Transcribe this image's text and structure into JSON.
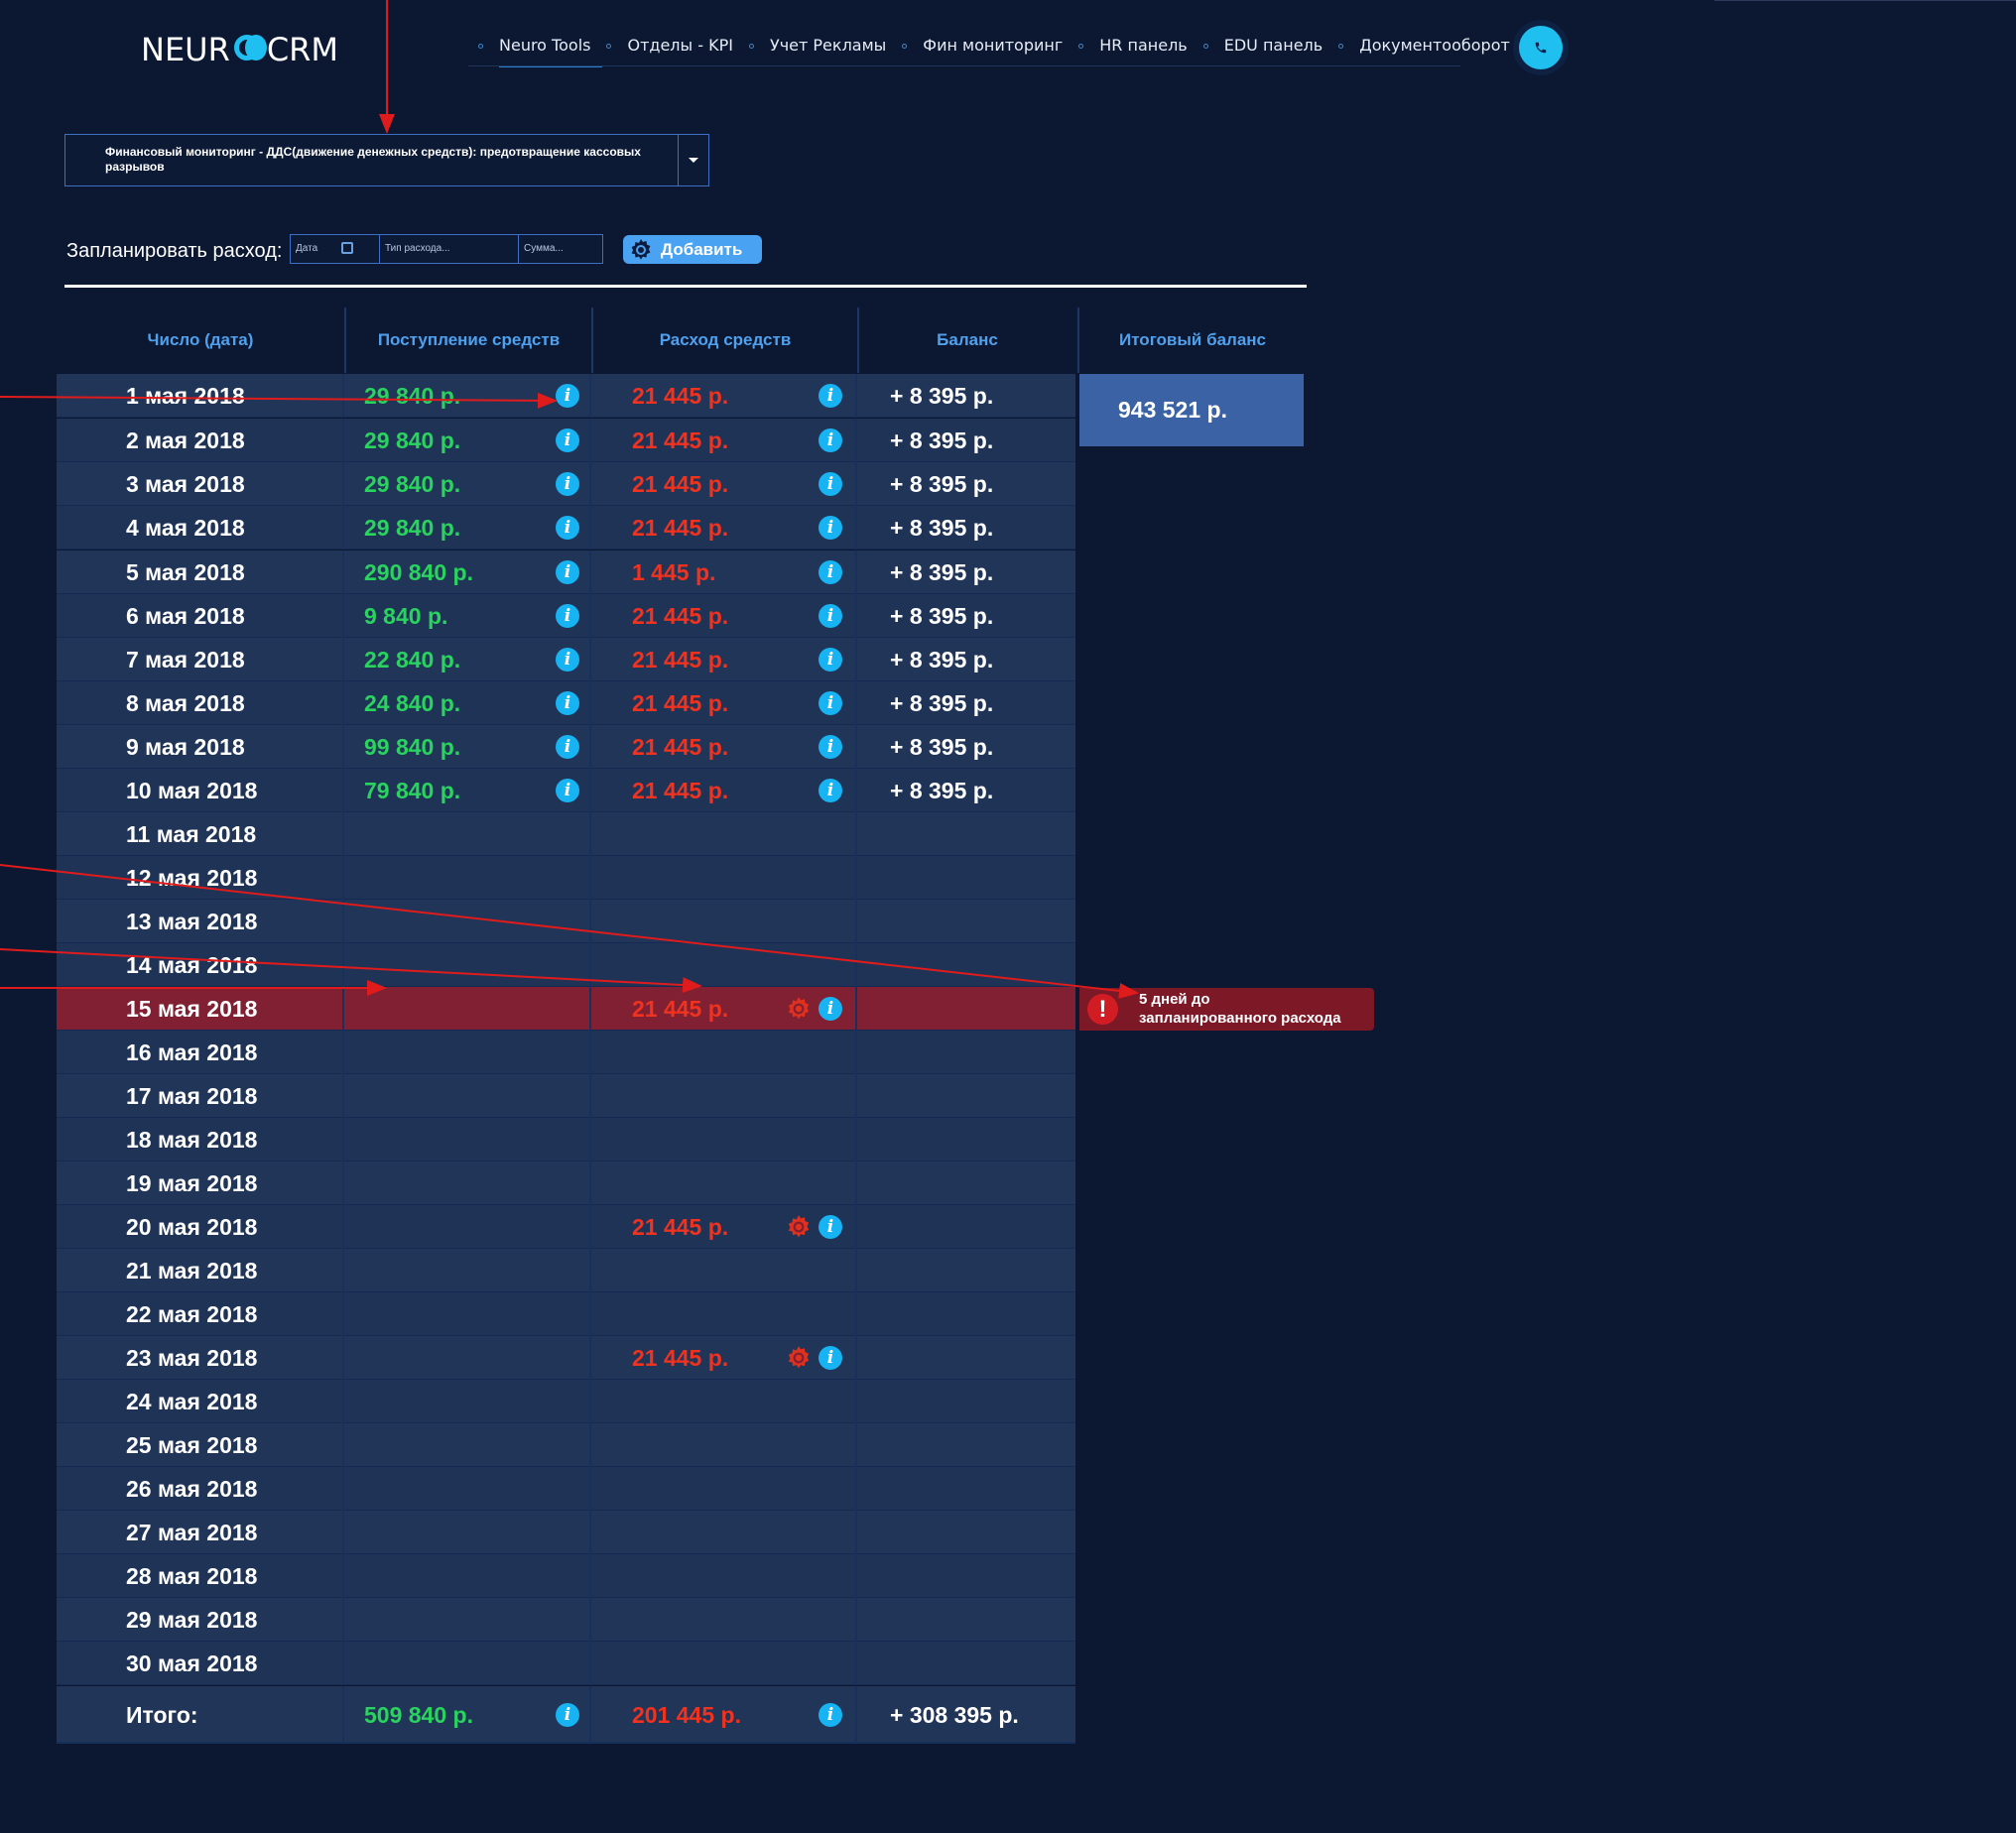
{
  "logo": {
    "left": "NEUR",
    "right": "CRM"
  },
  "nav": {
    "items": [
      {
        "label": "Neuro Tools",
        "active": true
      },
      {
        "label": "Отделы - KPI"
      },
      {
        "label": "Учет Рекламы"
      },
      {
        "label": "Фин мониторинг"
      },
      {
        "label": "HR панель"
      },
      {
        "label": "EDU панель"
      },
      {
        "label": "Документооборот"
      }
    ]
  },
  "call_icon": "phone-icon",
  "dropdown": {
    "selected": "Финансовый мониторинг - ДДС(движение денежных средств): предотвращение кассовых разрывов"
  },
  "plan": {
    "label": "Запланировать расход:",
    "date_placeholder": "Дата",
    "type_placeholder": "Тип расхода...",
    "sum_placeholder": "Сумма...",
    "add_label": "Добавить"
  },
  "table": {
    "headers": {
      "date": "Число (дата)",
      "income": "Поступление средств",
      "expense": "Расход средств",
      "balance": "Баланс",
      "final": "Итоговый баланс"
    },
    "rows": [
      {
        "date": "1 мая 2018",
        "income": "29 840 р.",
        "expense": "21 445 р.",
        "balance": "+ 8 395 р."
      },
      {
        "date": "2 мая 2018",
        "income": "29 840 р.",
        "expense": "21 445 р.",
        "balance": "+ 8 395 р."
      },
      {
        "date": "3 мая 2018",
        "income": "29 840 р.",
        "expense": "21 445 р.",
        "balance": "+ 8 395 р."
      },
      {
        "date": "4 мая 2018",
        "income": "29 840 р.",
        "expense": "21 445 р.",
        "balance": "+ 8 395 р."
      },
      {
        "date": "5 мая 2018",
        "income": "290 840 р.",
        "expense": "1 445 р.",
        "balance": "+ 8 395 р."
      },
      {
        "date": "6 мая 2018",
        "income": "9 840 р.",
        "expense": "21 445 р.",
        "balance": "+ 8 395 р."
      },
      {
        "date": "7 мая 2018",
        "income": "22 840 р.",
        "expense": "21 445 р.",
        "balance": "+ 8 395 р."
      },
      {
        "date": "8 мая 2018",
        "income": "24 840 р.",
        "expense": "21 445 р.",
        "balance": "+ 8 395 р."
      },
      {
        "date": "9 мая 2018",
        "income": "99 840 р.",
        "expense": "21 445 р.",
        "balance": "+ 8 395 р."
      },
      {
        "date": "10 мая 2018",
        "income": "79 840 р.",
        "expense": "21 445 р.",
        "balance": "+ 8 395 р."
      },
      {
        "date": "11 мая 2018"
      },
      {
        "date": "12 мая 2018"
      },
      {
        "date": "13 мая 2018"
      },
      {
        "date": "14 мая 2018"
      },
      {
        "date": "15 мая 2018",
        "expense": "21 445 р.",
        "planned": true,
        "highlight": true
      },
      {
        "date": "16 мая 2018"
      },
      {
        "date": "17 мая 2018"
      },
      {
        "date": "18 мая 2018"
      },
      {
        "date": "19 мая 2018"
      },
      {
        "date": "20 мая 2018",
        "expense": "21 445 р.",
        "planned": true
      },
      {
        "date": "21 мая 2018"
      },
      {
        "date": "22 мая 2018"
      },
      {
        "date": "23 мая 2018",
        "expense": "21 445 р.",
        "planned": true
      },
      {
        "date": "24 мая 2018"
      },
      {
        "date": "25 мая 2018"
      },
      {
        "date": "26 мая 2018"
      },
      {
        "date": "27 мая 2018"
      },
      {
        "date": "28 мая 2018"
      },
      {
        "date": "29 мая 2018"
      },
      {
        "date": "30 мая 2018"
      }
    ],
    "total": {
      "label": "Итого:",
      "income": "509 840 р.",
      "expense": "201 445 р.",
      "balance": "+ 308 395 р."
    },
    "final_balance": "943 521 р."
  },
  "alert": {
    "text_line1": "5 дней до",
    "text_line2": "запланированного расхода",
    "icon": "exclamation-icon"
  },
  "colors": {
    "background": "#0c1832",
    "income": "#29d35e",
    "expense": "#f0321e",
    "accent": "#1fbff0",
    "header_text": "#4fa1ee",
    "highlight_row": "#812032"
  }
}
